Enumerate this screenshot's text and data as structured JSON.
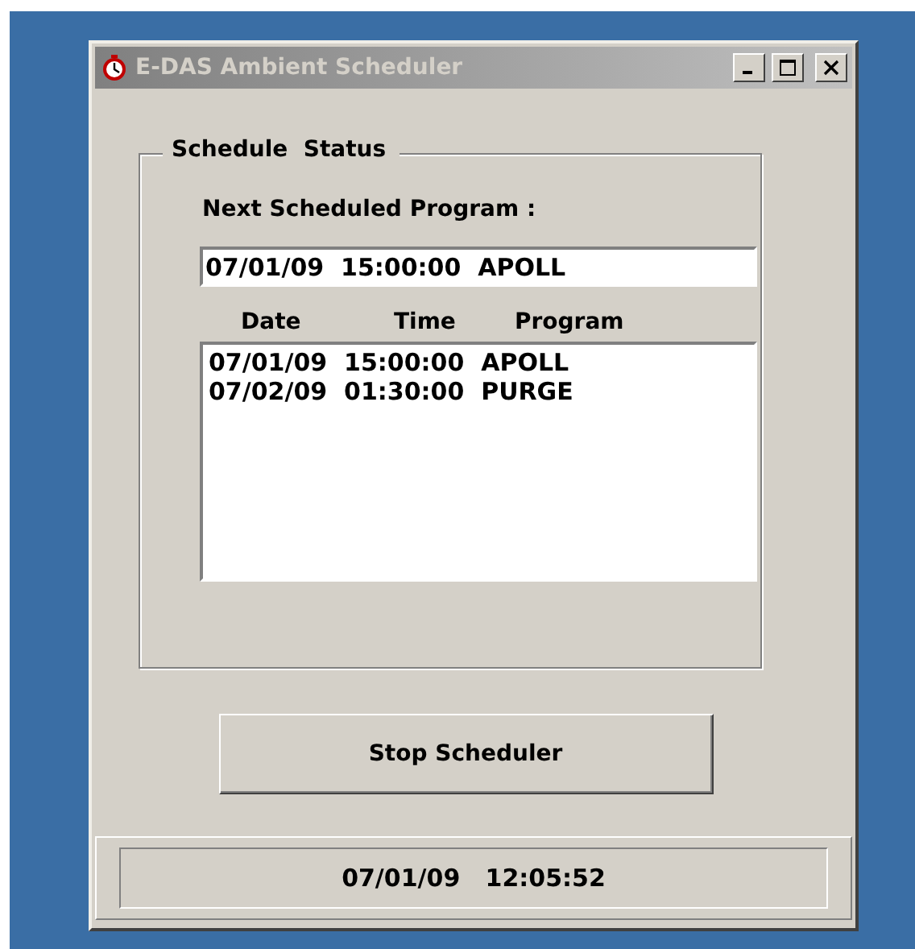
{
  "window": {
    "title": "E-DAS Ambient Scheduler",
    "active": false
  },
  "group": {
    "title": "Schedule  Status"
  },
  "next_program": {
    "label": "Next Scheduled Program :",
    "value": "07/01/09  15:00:00  APOLL"
  },
  "schedule_list": {
    "columns": [
      "Date",
      "Time",
      "Program"
    ],
    "rows": [
      "07/01/09  15:00:00  APOLL",
      "07/02/09  01:30:00  PURGE"
    ]
  },
  "buttons": [
    "Stop Scheduler"
  ],
  "status_bar": {
    "text": "07/01/09   12:05:52"
  }
}
